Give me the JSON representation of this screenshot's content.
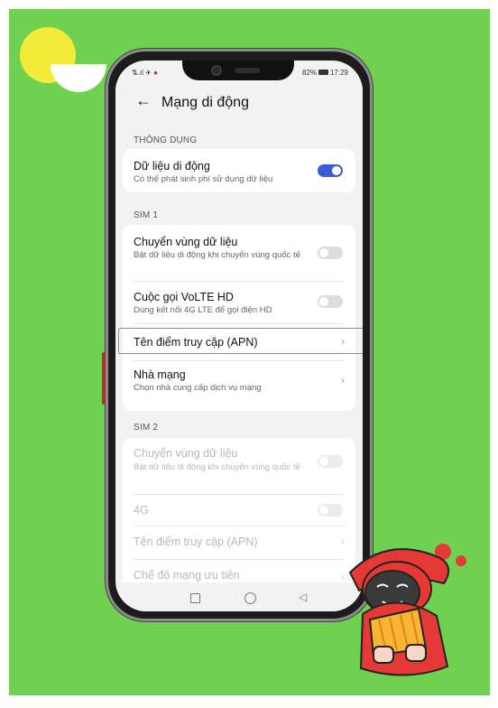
{
  "status_bar": {
    "left": "⇅.ıl ✈",
    "record": "●",
    "battery": "82%",
    "time": "17:29"
  },
  "header": {
    "title": "Mạng di động"
  },
  "sections": {
    "common": "THÔNG DỤNG",
    "sim1": "SIM 1",
    "sim2": "SIM 2"
  },
  "common": {
    "mobile_data": {
      "title": "Dữ liệu di động",
      "subtitle": "Có thể phát sinh phí sử dụng dữ liệu",
      "enabled": true
    }
  },
  "sim1": {
    "roaming": {
      "title": "Chuyển vùng dữ liệu",
      "subtitle": "Bật dữ liệu di động khi chuyển vùng quốc tế",
      "enabled": false
    },
    "volte": {
      "title": "Cuộc gọi VoLTE HD",
      "subtitle": "Dùng kết nối 4G LTE để gọi điện HD",
      "enabled": false
    },
    "apn": {
      "title": "Tên điểm truy cập (APN)"
    },
    "carrier": {
      "title": "Nhà mạng",
      "subtitle": "Chọn nhà cung cấp dịch vụ mạng"
    }
  },
  "sim2": {
    "roaming": {
      "title": "Chuyển vùng dữ liệu",
      "subtitle": "Bật dữ liệu di động khi chuyển vùng quốc tế"
    },
    "fourg": {
      "title": "4G"
    },
    "apn": {
      "title": "Tên điểm truy cập (APN)"
    },
    "preferred": {
      "title": "Chế độ mạng ưu tiên"
    }
  },
  "icons": {
    "back": "arrow-left-icon",
    "chevron": "chevron-right-icon"
  },
  "colors": {
    "background": "#6fd14f",
    "toggle_on": "#3b5bdb",
    "highlight": "#4bbf3c"
  }
}
